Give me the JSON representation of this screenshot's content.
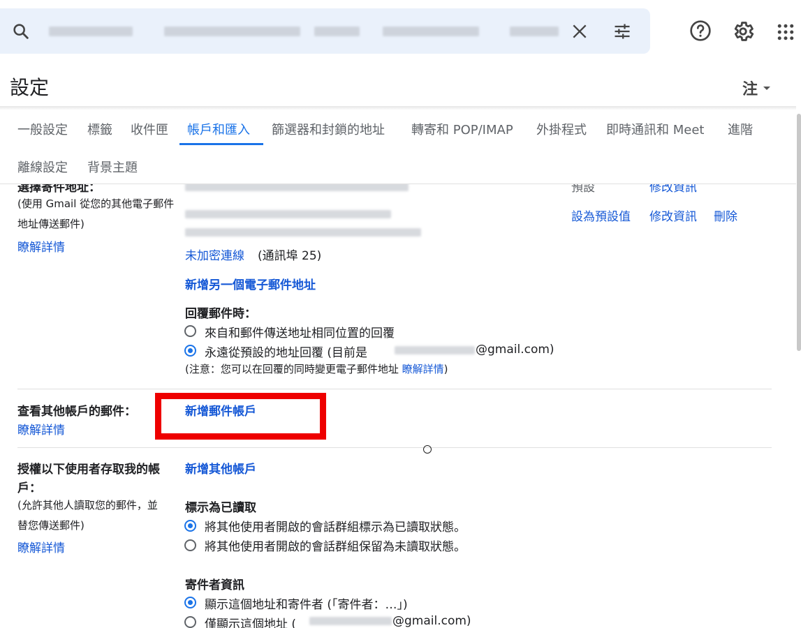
{
  "search": {
    "value": "",
    "icons": [
      "search-icon",
      "clear-icon",
      "tune-icon"
    ]
  },
  "header_icons": [
    "help-icon",
    "gear-icon",
    "apps-icon"
  ],
  "title": "設定",
  "language": "注",
  "tabs": [
    {
      "label": "一般設定"
    },
    {
      "label": "標籤"
    },
    {
      "label": "收件匣"
    },
    {
      "label": "帳戶和匯入",
      "active": true
    },
    {
      "label": "篩選器和封鎖的地址"
    },
    {
      "label": "轉寄和 POP/IMAP"
    },
    {
      "label": "外掛程式"
    },
    {
      "label": "即時通訊和 Meet"
    },
    {
      "label": "進階"
    },
    {
      "label": "離線設定"
    },
    {
      "label": "背景主題"
    }
  ],
  "send_mail_as": {
    "title": "選擇寄件地址：",
    "desc": "(使用 Gmail 從您的其他電子郵件地址傳送郵件)",
    "learn_more": "瞭解詳情",
    "default_badge": "預設",
    "edit_info_top": "修改資訊",
    "set_default": "設為預設值",
    "edit_info": "修改資訊",
    "delete": "刪除",
    "unencrypted": "未加密連線",
    "port": "(通訊埠 25)",
    "add_another": "新增另一個電子郵件地址",
    "reply_heading": "回覆郵件時：",
    "reply_option_1": "來自和郵件傳送地址相同位置的回覆",
    "reply_option_2_prefix": "永遠從預設的地址回覆 (目前是",
    "reply_option_2_suffix": "@gmail.com)",
    "reply_note_prefix": "(注意：您可以在回覆的同時變更電子郵件地址",
    "reply_note_link": "瞭解詳情",
    "reply_note_suffix": ")"
  },
  "check_mail": {
    "title": "查看其他帳戶的郵件：",
    "learn_more": "瞭解詳情",
    "add_account": "新增郵件帳戶"
  },
  "grant_access": {
    "title_line1": "授權以下使用者存取我的帳",
    "title_line2": "戶：",
    "desc_line1": "(允許其他人讀取您的郵件，並",
    "desc_line2": "替您傳送郵件)",
    "learn_more": "瞭解詳情",
    "add_account": "新增其他帳戶",
    "mark_read_heading": "標示為已讀取",
    "mark_read_option_1": "將其他使用者開啟的會話群組標示為已讀取狀態。",
    "mark_read_option_2": "將其他使用者開啟的會話群組保留為未讀取狀態。",
    "sender_info_heading": "寄件者資訊",
    "sender_option_1": "顯示這個地址和寄件者 (「寄件者：…」)",
    "sender_option_2_prefix": "僅顯示這個地址 (",
    "sender_option_2_suffix": "@gmail.com)"
  },
  "colors": {
    "accent": "#1a73e8",
    "link": "#1558d6",
    "highlight": "#ee0000",
    "search_bg": "#eaf1fb"
  }
}
